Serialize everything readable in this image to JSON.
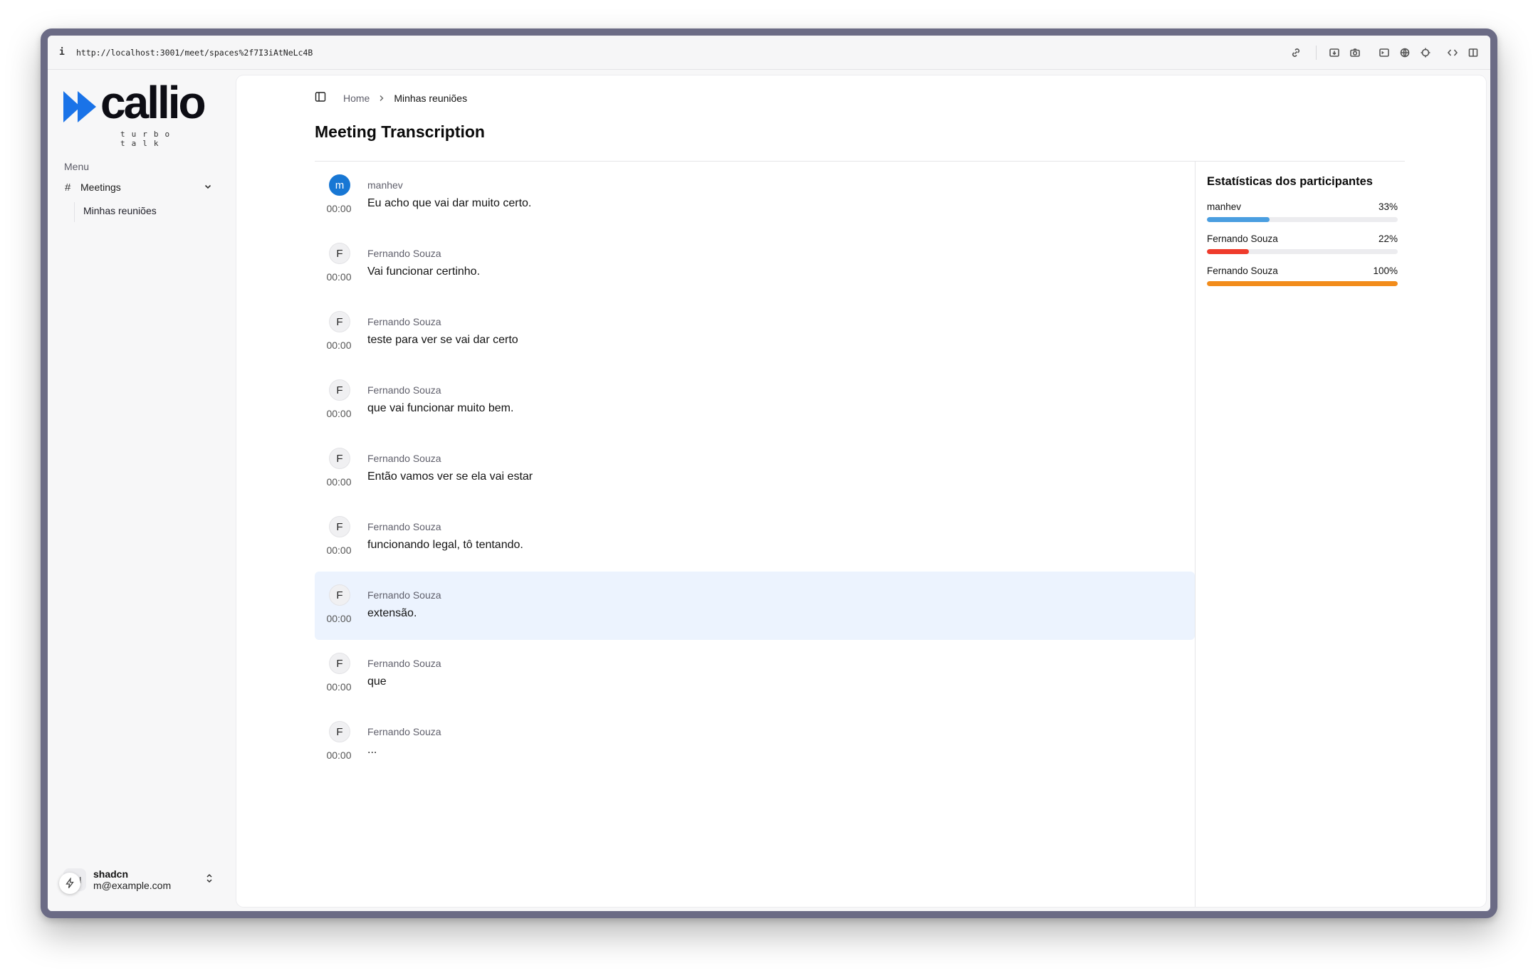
{
  "browser": {
    "url": "http://localhost:3001/meet/spaces%2f7I3iAtNeLc4B"
  },
  "brand": {
    "name": "callio",
    "tagline": "turbo talk",
    "accent": "#1a73e8"
  },
  "sidebar": {
    "menu_label": "Menu",
    "group_label": "Meetings",
    "sub_items": [
      {
        "label": "Minhas reuniões"
      }
    ]
  },
  "user": {
    "name": "shadcn",
    "email": "m@example.com",
    "initials": "CN"
  },
  "breadcrumb": {
    "home": "Home",
    "current": "Minhas reuniões"
  },
  "page": {
    "title": "Meeting Transcription"
  },
  "transcript": [
    {
      "initial": "m",
      "speaker": "manhev",
      "time": "00:00",
      "text": "Eu acho que vai dar muito certo."
    },
    {
      "initial": "F",
      "speaker": "Fernando Souza",
      "time": "00:00",
      "text": "Vai funcionar certinho."
    },
    {
      "initial": "F",
      "speaker": "Fernando Souza",
      "time": "00:00",
      "text": "teste para ver se vai dar certo"
    },
    {
      "initial": "F",
      "speaker": "Fernando Souza",
      "time": "00:00",
      "text": "que vai funcionar muito bem."
    },
    {
      "initial": "F",
      "speaker": "Fernando Souza",
      "time": "00:00",
      "text": "Então vamos ver se ela vai estar"
    },
    {
      "initial": "F",
      "speaker": "Fernando Souza",
      "time": "00:00",
      "text": "funcionando legal, tô tentando."
    },
    {
      "initial": "F",
      "speaker": "Fernando Souza",
      "time": "00:00",
      "text": "extensão."
    },
    {
      "initial": "F",
      "speaker": "Fernando Souza",
      "time": "00:00",
      "text": "que"
    },
    {
      "initial": "F",
      "speaker": "Fernando Souza",
      "time": "00:00",
      "text": "..."
    }
  ],
  "stats": {
    "title": "Estatísticas dos participantes",
    "participants": [
      {
        "name": "manhev",
        "percent_label": "33%",
        "percent": 33,
        "color": "#4a9ee0"
      },
      {
        "name": "Fernando Souza",
        "percent_label": "22%",
        "percent": 22,
        "color": "#ef3b2c"
      },
      {
        "name": "Fernando Souza",
        "percent_label": "100%",
        "percent": 100,
        "color": "#f28c1b"
      }
    ]
  }
}
